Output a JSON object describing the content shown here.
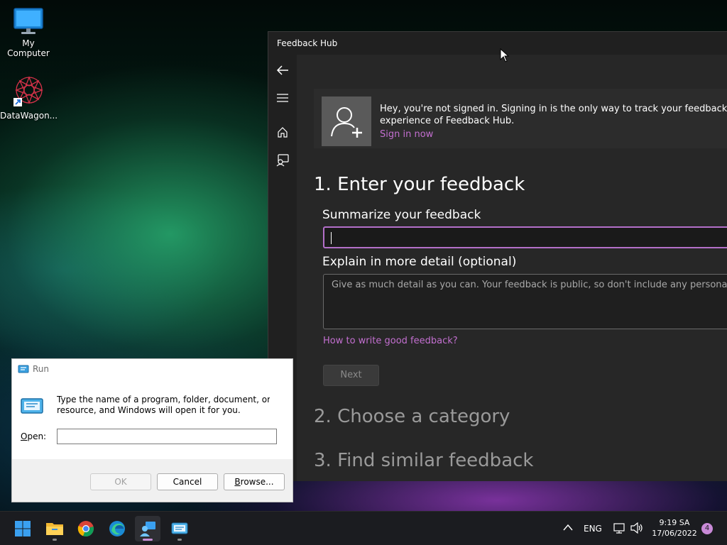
{
  "desktop": {
    "icons": [
      {
        "label": "My Computer",
        "icon": "monitor-icon"
      },
      {
        "label": "DataWagon...",
        "icon": "datawagon-shortcut-icon"
      }
    ]
  },
  "feedback_hub": {
    "title": "Feedback Hub",
    "nav": [
      "back-arrow-icon",
      "hamburger-menu-icon",
      "home-icon",
      "feedback-icon",
      "account-icon",
      "settings-gear-icon"
    ],
    "signin_banner": {
      "line1": "Hey, you're not signed in. Signing in is the only way to track your feedback and",
      "line2": "experience of Feedback Hub.",
      "link": "Sign in now"
    },
    "section1": "1. Enter your feedback",
    "summarize_label": "Summarize your feedback",
    "summarize_value": "",
    "detail_label": "Explain in more detail (optional)",
    "detail_placeholder": "Give as much detail as you can. Your feedback is public, so don't include any personal infor",
    "howto_link": "How to write good feedback?",
    "next_label": "Next",
    "section2": "2. Choose a category",
    "section3": "3. Find similar feedback",
    "accent_color": "#c36fd0"
  },
  "run_dialog": {
    "title": "Run",
    "description_line1": "Type the name of a program, folder, document, or Intern",
    "description_line2": "resource, and Windows will open it for you.",
    "open_label": "Open:",
    "open_value": "",
    "ok_label": "OK",
    "cancel_label": "Cancel",
    "browse_label": "Browse..."
  },
  "taskbar": {
    "apps": [
      "windows-start-icon",
      "file-explorer-icon",
      "chrome-icon",
      "edge-icon",
      "feedback-hub-icon",
      "run-icon"
    ],
    "active_app": "feedback-hub-icon",
    "language": "ENG",
    "time": "9:19 SA",
    "date": "17/06/2022",
    "notification_count": "4"
  }
}
